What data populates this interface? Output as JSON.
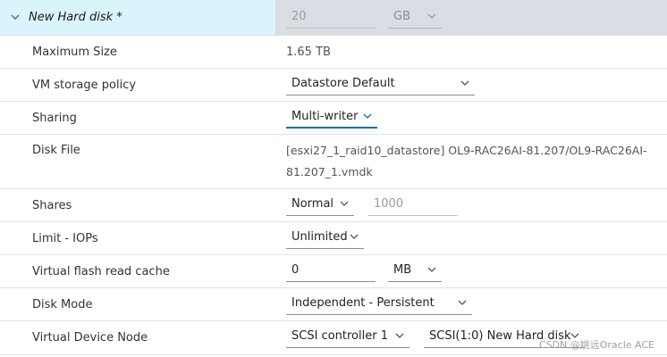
{
  "disk": {
    "title": "New Hard disk *",
    "size_value": "20",
    "size_unit": "GB"
  },
  "rows": {
    "max_size": {
      "label": "Maximum Size",
      "value": "1.65 TB"
    },
    "storage_policy": {
      "label": "VM storage policy",
      "value": "Datastore Default"
    },
    "sharing": {
      "label": "Sharing",
      "value": "Multi-writer"
    },
    "disk_file": {
      "label": "Disk File",
      "line1": "[esxi27_1_raid10_datastore] OL9-RAC26AI-81.207/OL9-RAC26AI-",
      "line2": "81.207_1.vmdk"
    },
    "shares": {
      "label": "Shares",
      "value": "Normal",
      "number": "1000"
    },
    "limit_iops": {
      "label": "Limit - IOPs",
      "value": "Unlimited"
    },
    "flash_cache": {
      "label": "Virtual flash read cache",
      "value": "0",
      "unit": "MB"
    },
    "disk_mode": {
      "label": "Disk Mode",
      "value": "Independent - Persistent"
    },
    "device_node": {
      "label": "Virtual Device Node",
      "controller": "SCSI controller 1",
      "node": "SCSI(1:0) New Hard disk"
    }
  },
  "watermark": "CSDN @姚远Oracle ACE",
  "colors": {
    "header_bg": "#d9f4fb",
    "header_right_bg": "#d8dee3",
    "active_underline": "#0072a3"
  },
  "icons": {
    "expand": "chevron-down-icon",
    "dropdown": "chevron-down-icon"
  }
}
